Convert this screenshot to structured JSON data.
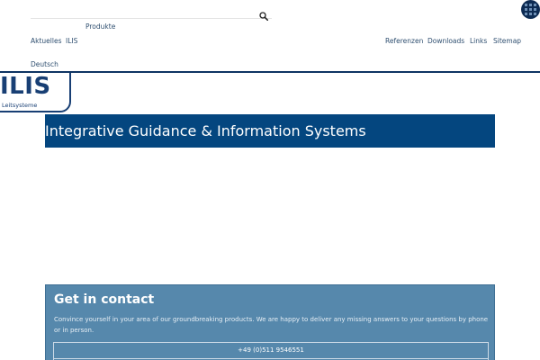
{
  "search": {
    "placeholder": "",
    "value": ""
  },
  "nav": {
    "produkte": "Produkte",
    "aktuelles": "Aktuelles",
    "ilis": "ILIS",
    "referenzen": "Referenzen",
    "downloads": "Downloads",
    "links": "Links",
    "sitemap": "Sitemap",
    "language": "Deutsch"
  },
  "logo": {
    "wordmark": "ILIS",
    "tagline": "Leitsysteme"
  },
  "hero": {
    "title": "Integrative Guidance & Information Systems"
  },
  "contact": {
    "heading": "Get in contact",
    "text": "Convince yourself in your area of our groundbreaking products. We are happy to deliver any missing answers to your questions by phone or in person.",
    "phone": "+49 (0)511 9546551"
  },
  "colors": {
    "brand_blue": "#04467f",
    "panel_blue": "#5688ac",
    "nav_text": "#2f4f70"
  },
  "icons": {
    "search": "search-icon",
    "menu": "grid-icon"
  }
}
